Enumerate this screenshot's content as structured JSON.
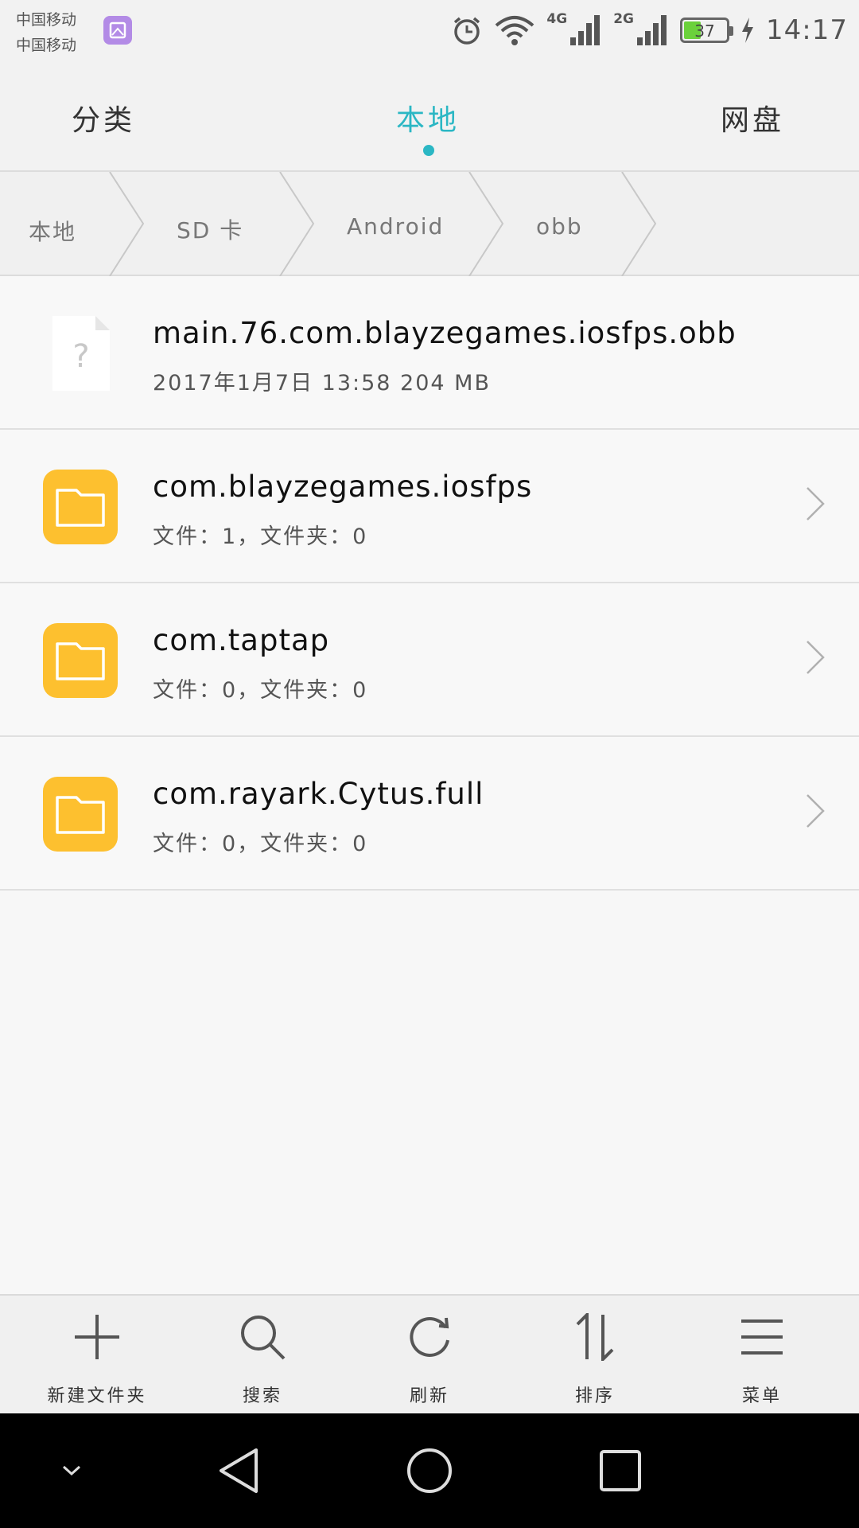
{
  "status_bar": {
    "carrier_1": "中国移动",
    "carrier_2": "中国移动",
    "network_1": "4G",
    "network_2": "2G",
    "battery": "37",
    "battery_level": 0.37,
    "time": "14:17"
  },
  "tabs": [
    {
      "label": "分类",
      "active": false
    },
    {
      "label": "本地",
      "active": true
    },
    {
      "label": "网盘",
      "active": false
    }
  ],
  "breadcrumb": [
    "本地",
    "SD 卡",
    "Android",
    "obb"
  ],
  "files": [
    {
      "type": "file",
      "name": "main.76.com.blayzegames.iosfps.obb",
      "meta": "2017年1月7日 13:58 204 MB"
    },
    {
      "type": "folder",
      "name": "com.blayzegames.iosfps",
      "meta": "文件：1，文件夹：0"
    },
    {
      "type": "folder",
      "name": "com.taptap",
      "meta": "文件：0，文件夹：0"
    },
    {
      "type": "folder",
      "name": "com.rayark.Cytus.full",
      "meta": "文件：0，文件夹：0"
    }
  ],
  "toolbar": {
    "new_folder": "新建文件夹",
    "search": "搜索",
    "refresh": "刷新",
    "sort": "排序",
    "menu": "菜单"
  },
  "colors": {
    "accent": "#2bb7c4",
    "folder": "#fdc02f",
    "battery_fill": "#6bd13b"
  },
  "icons": {
    "file": "unknown-file-icon",
    "folder": "folder-icon",
    "chevron": "chevron-right-icon"
  }
}
